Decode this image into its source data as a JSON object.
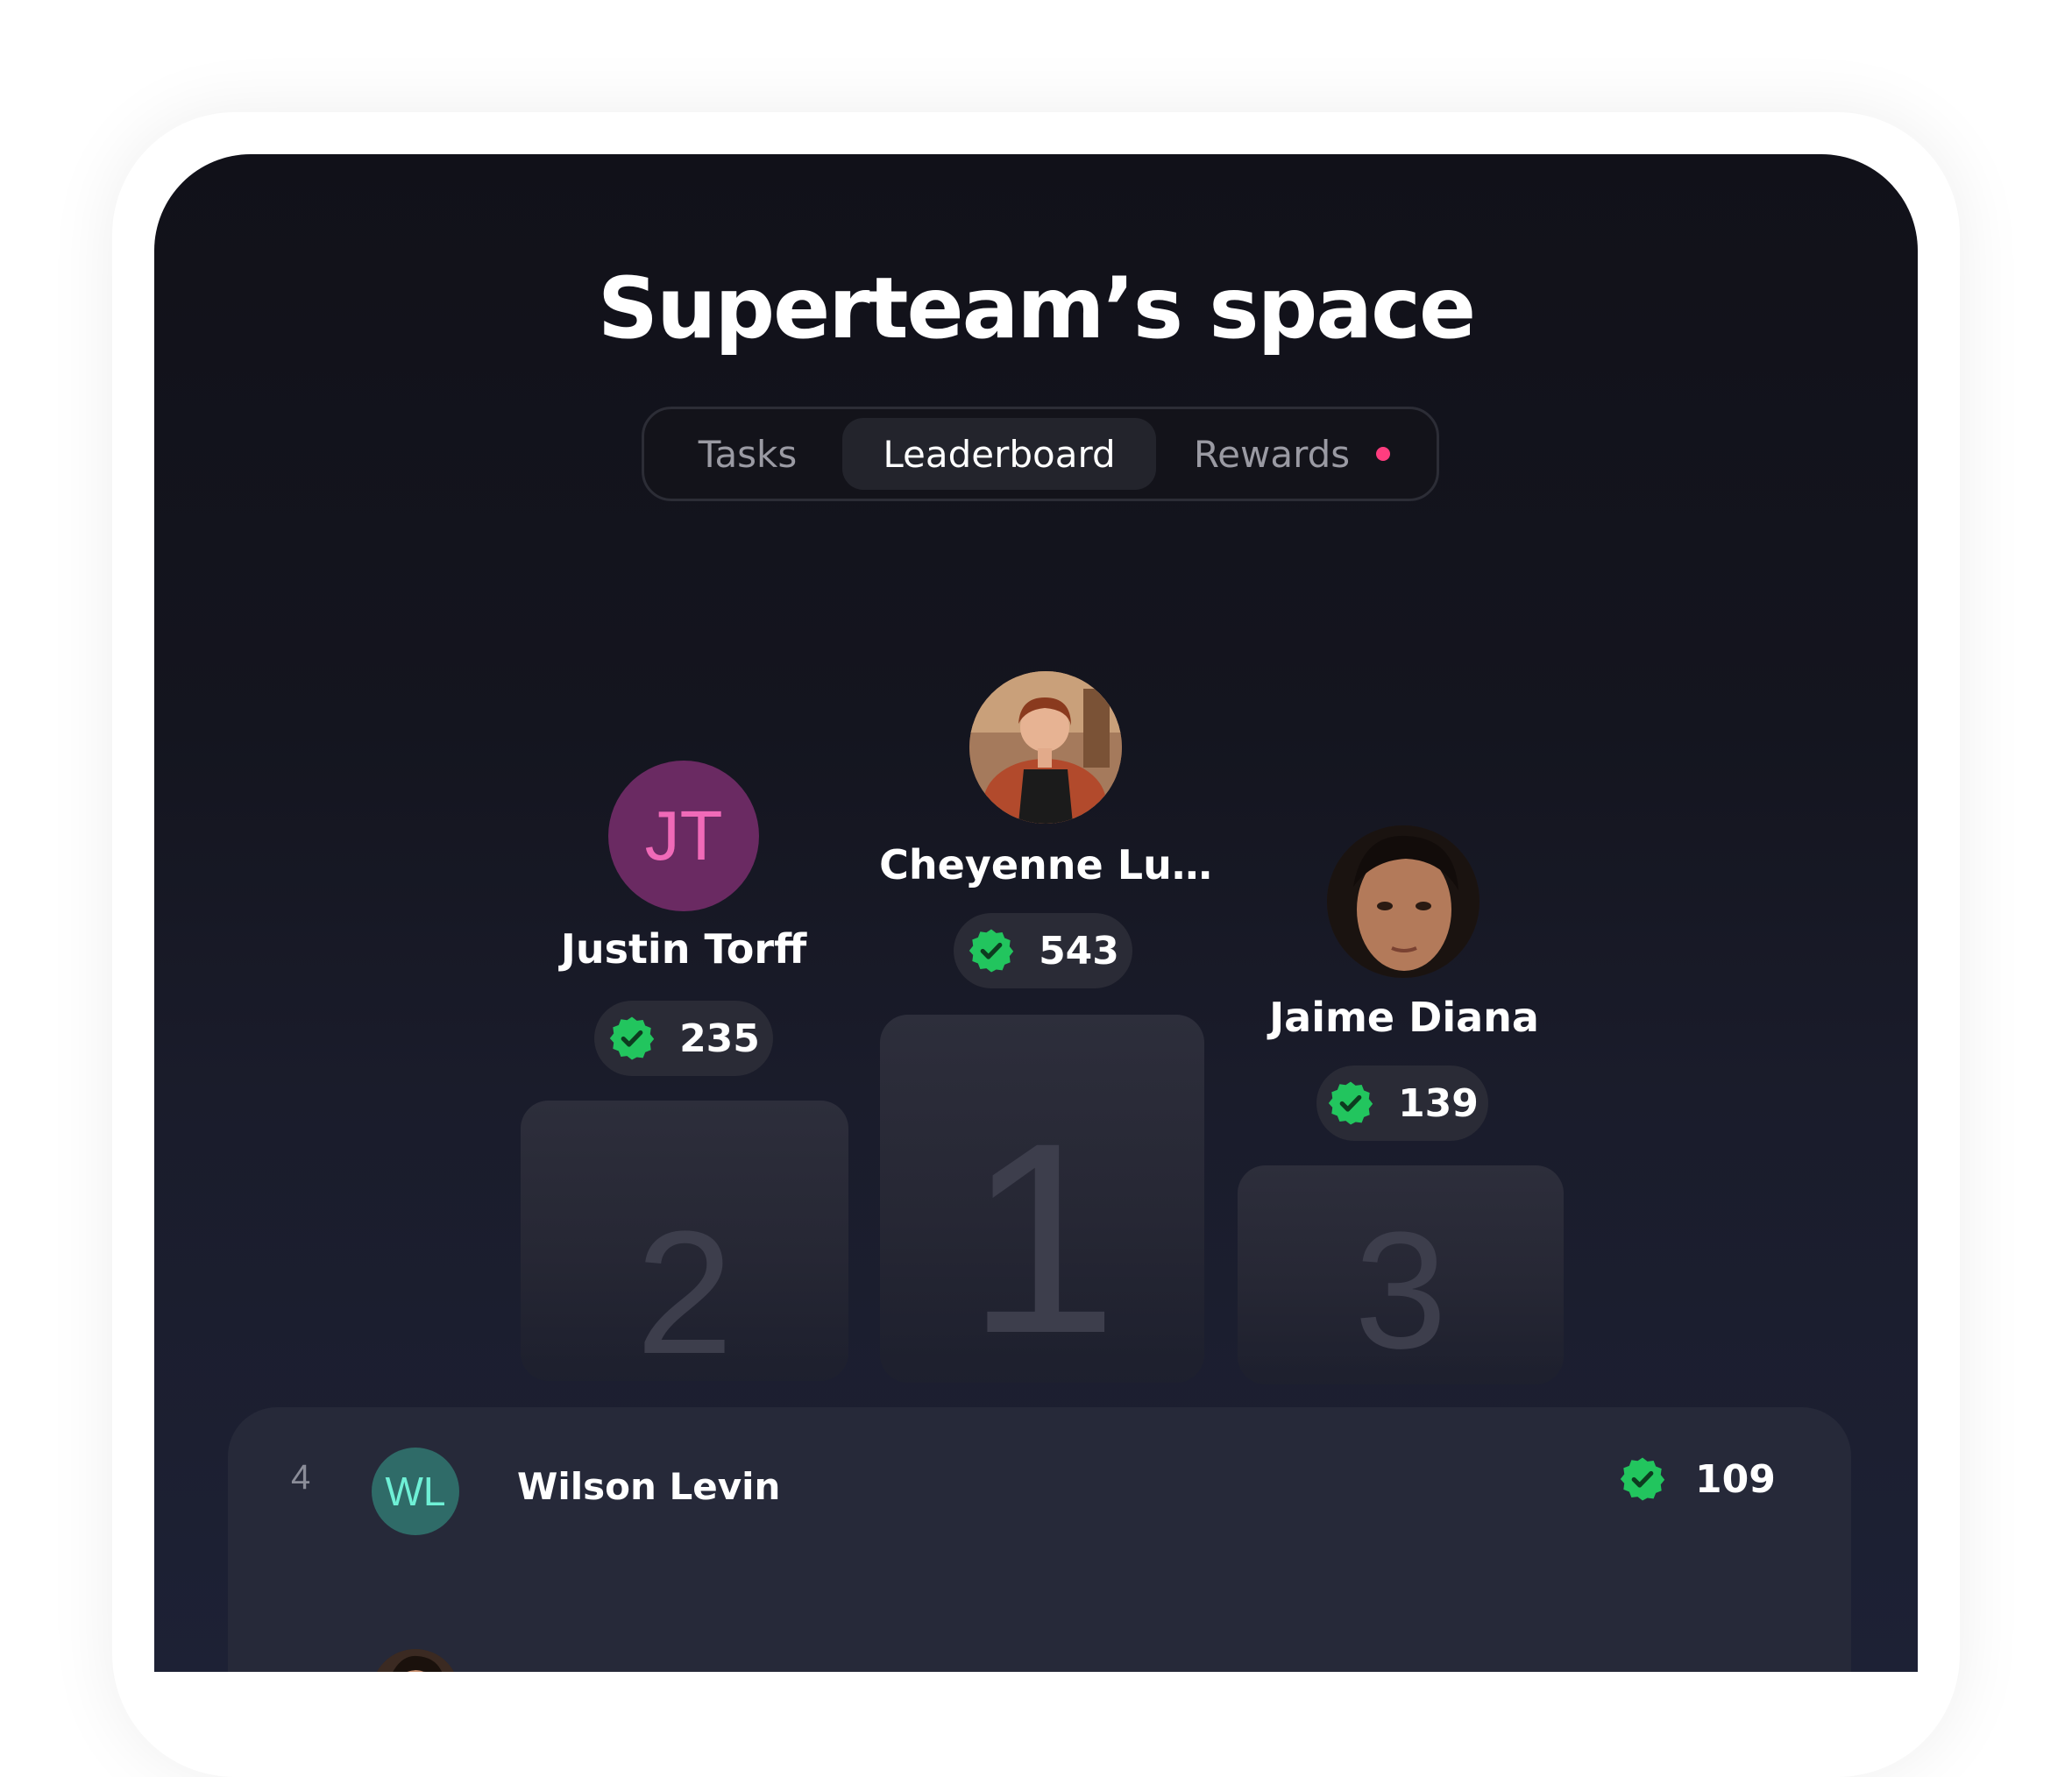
{
  "title": "Superteam’s space",
  "tabs": [
    {
      "label": "Tasks",
      "active": false
    },
    {
      "label": "Leaderboard",
      "active": true
    },
    {
      "label": "Rewards",
      "active": false,
      "notification_dot": true
    }
  ],
  "colors": {
    "accent_green": "#22c55e",
    "notification_pink": "#ff3d7f",
    "background_dark": "#111119"
  },
  "podium": [
    {
      "rank": "2",
      "name": "Justin Torff",
      "initials": "JT",
      "points": "235"
    },
    {
      "rank": "1",
      "name": "Cheyenne Lu…",
      "avatar": "photo",
      "points": "543"
    },
    {
      "rank": "3",
      "name": "Jaime Diana",
      "avatar": "photo",
      "points": "139"
    }
  ],
  "list": [
    {
      "rank": "4",
      "initials": "WL",
      "name": "Wilson Levin",
      "points": "109"
    }
  ],
  "icons": {
    "points": "verified-badge-icon"
  }
}
